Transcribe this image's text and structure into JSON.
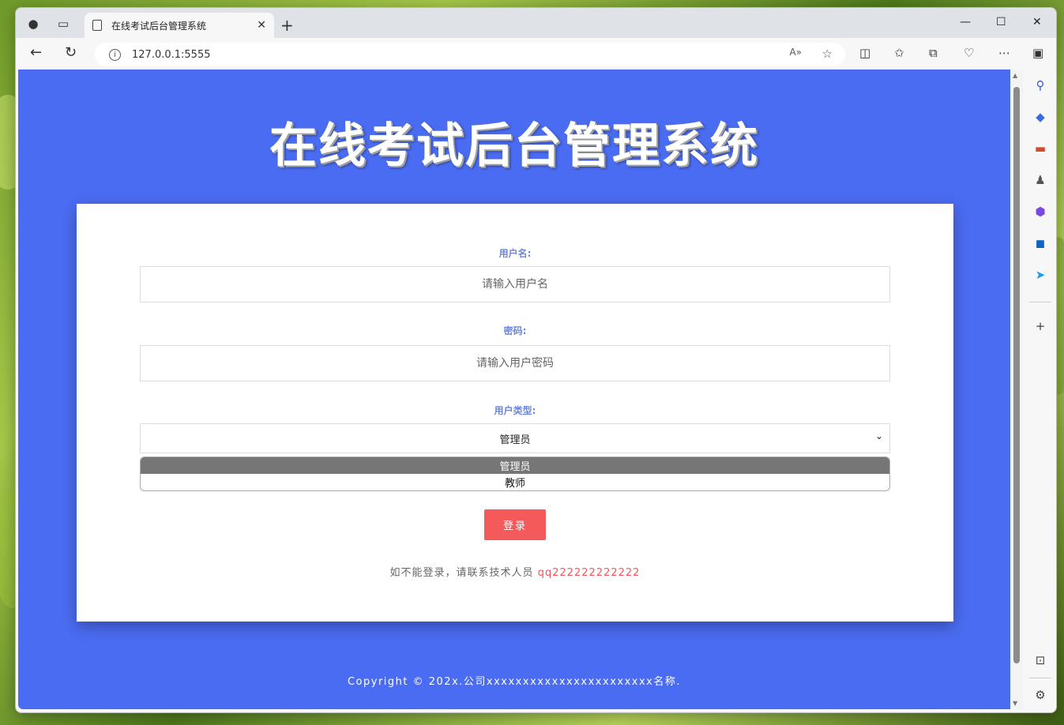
{
  "browser": {
    "tab_title": "在线考试后台管理系统",
    "tab_close": "✕",
    "new_tab": "+",
    "url": "127.0.0.1:5555",
    "read_aloud": "A»",
    "minimize": "—",
    "maximize": "☐",
    "close": "✕"
  },
  "page": {
    "title": "在线考试后台管理系统",
    "username_label": "用户名:",
    "username_placeholder": "请输入用户名",
    "password_label": "密码:",
    "password_placeholder": "请输入用户密码",
    "usertype_label": "用户类型:",
    "usertype_selected": "管理员",
    "usertype_options": [
      "管理员",
      "教师"
    ],
    "login_button": "登录",
    "help_text": "如不能登录，请联系技术人员",
    "help_qq": "qq222222222222",
    "footer": "Copyright © 202x.公司xxxxxxxxxxxxxxxxxxxxxxx名称."
  },
  "colors": {
    "page_bg": "#4a6cf2",
    "label": "#6a86e0",
    "button": "#f55a5a",
    "qq": "#f0555a"
  }
}
